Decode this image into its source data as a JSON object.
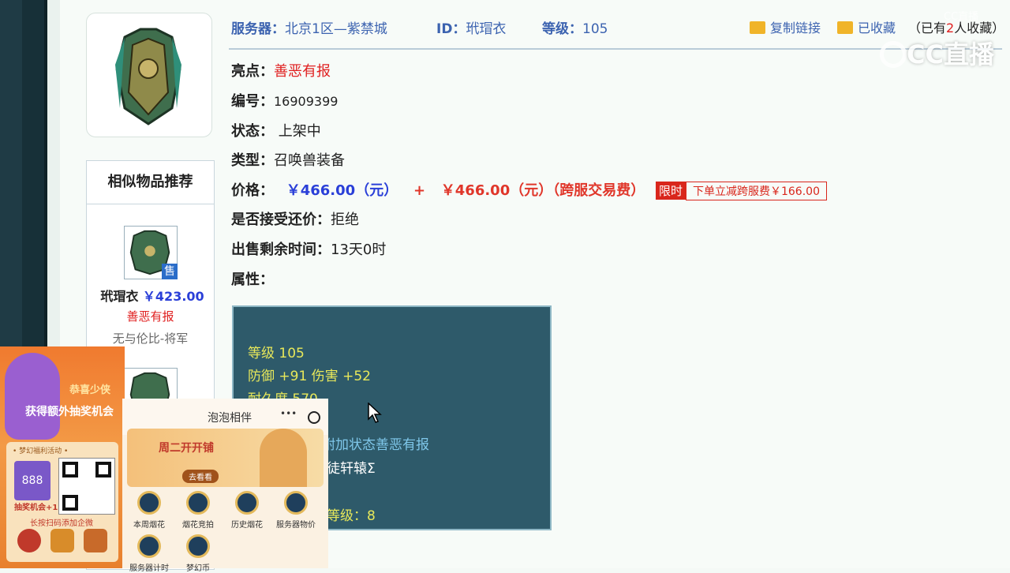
{
  "header": {
    "server_label": "服务器：",
    "server_value": "北京1区—紫禁城",
    "id_label": "ID：",
    "id_value": "玳瑁衣",
    "level_label": "等级：",
    "level_value": "105",
    "copy_link": "复制链接",
    "collected": "已收藏",
    "collect_prefix": "（已有",
    "collect_count": "2",
    "collect_suffix": "人收藏）"
  },
  "details": {
    "highlight_label": "亮点：",
    "highlight_value": "善恶有报",
    "number_label": "编号：",
    "number_value": "16909399",
    "status_label": "状态：",
    "status_value": "上架中",
    "type_label": "类型：",
    "type_value": "召唤兽装备",
    "price_label": "价格：",
    "price_value": "￥466.00（元）",
    "price_plus": "+",
    "cross_fee": "￥466.00（元）（跨服交易费）",
    "limited_tag": "限时",
    "limited_desc": "下单立减跨服费￥166.00",
    "bargain_label": "是否接受还价：",
    "bargain_value": "拒绝",
    "remaining_label": "出售剩余时间：",
    "remaining_value": "13天0时",
    "attr_label": "属性："
  },
  "attributes": {
    "line1": "等级 105",
    "line2": "防御 +91 伤害 +52",
    "line3": "耐久度 570",
    "line4": "附加状态善恶有报",
    "line5": "徒轩辕Σ",
    "line6": "等级：8"
  },
  "similar": {
    "title": "相似物品推荐",
    "items": [
      {
        "name": "玳瑁衣",
        "price": "￥423.00",
        "highlight": "善恶有报",
        "server": "无与伦比-将军",
        "badge": "售"
      }
    ]
  },
  "overlay_promo": {
    "title1": "恭喜少侠",
    "title2": "获得额外抽奖机会",
    "card_head": "• 梦幻福利活动 •",
    "amount": "888",
    "chance": "抽奖机会+1",
    "scan_tip": "长按扫码添加企微"
  },
  "overlay_app": {
    "title": "泡泡相伴",
    "more_icon": "•••",
    "banner_text": "周二开开铺",
    "banner_btn": "去看看",
    "icons": [
      "本周烟花",
      "烟花竞拍",
      "历史烟花",
      "服务器物价",
      "服务器计时",
      "梦幻币"
    ]
  },
  "watermark": {
    "logo_text": "CC直播",
    "small_text": "CC直播"
  },
  "colors": {
    "link_blue": "#3c63b0",
    "price_blue": "#2a3fd8",
    "red": "#e02020",
    "attr_bg": "#2e5a6a",
    "attr_text": "#e8e85a"
  }
}
